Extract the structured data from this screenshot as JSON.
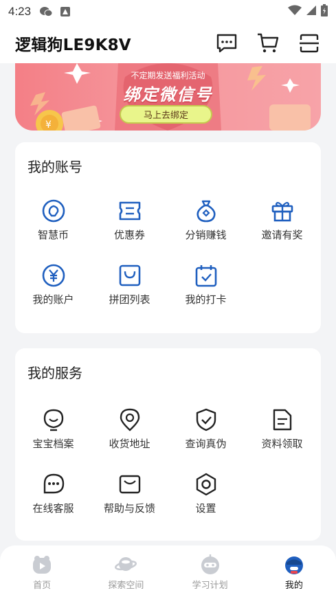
{
  "status_bar": {
    "time": "4:23"
  },
  "header": {
    "title": "逻辑狗LE9K8V"
  },
  "banner": {
    "tagline": "不定期发送福利活动",
    "headline": "绑定微信号",
    "button_label": "马上去绑定"
  },
  "account_card": {
    "title": "我的账号",
    "items": [
      {
        "label": "智慧币",
        "icon": "coin-icon"
      },
      {
        "label": "优惠券",
        "icon": "coupon-icon"
      },
      {
        "label": "分销赚钱",
        "icon": "money-bag-icon"
      },
      {
        "label": "邀请有奖",
        "icon": "gift-icon"
      },
      {
        "label": "我的账户",
        "icon": "yuan-icon"
      },
      {
        "label": "拼团列表",
        "icon": "shopping-bag-icon"
      },
      {
        "label": "我的打卡",
        "icon": "calendar-check-icon"
      }
    ]
  },
  "services_card": {
    "title": "我的服务",
    "items": [
      {
        "label": "宝宝档案",
        "icon": "baby-face-icon"
      },
      {
        "label": "收货地址",
        "icon": "location-pin-icon"
      },
      {
        "label": "查询真伪",
        "icon": "shield-check-icon"
      },
      {
        "label": "资料领取",
        "icon": "document-icon"
      },
      {
        "label": "在线客服",
        "icon": "chat-bubble-icon"
      },
      {
        "label": "帮助与反馈",
        "icon": "mail-icon"
      },
      {
        "label": "设置",
        "icon": "hexagon-settings-icon"
      }
    ]
  },
  "tabbar": {
    "tabs": [
      {
        "label": "首页",
        "active": false
      },
      {
        "label": "探索空间",
        "active": false
      },
      {
        "label": "学习计划",
        "active": false
      },
      {
        "label": "我的",
        "active": true
      }
    ]
  },
  "colors": {
    "accent": "#1f5fbf",
    "banner": "#f47f86",
    "background": "#f3f4f6"
  }
}
